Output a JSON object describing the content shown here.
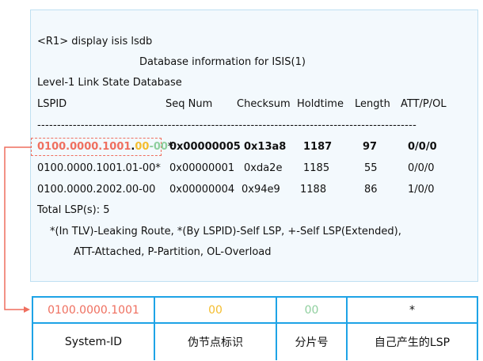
{
  "terminal": {
    "command": "<R1> display isis lsdb",
    "title": "Database information for ISIS(1)",
    "level": "Level-1 Link State Database",
    "headers": [
      "LSPID",
      "Seq Num",
      "Checksum",
      "Holdtime",
      "Length",
      "ATT/P/OL"
    ],
    "separator": "------------------------------------------------------------------------------------------------",
    "highlight_row": {
      "system_id": "0100.0000.1001",
      "dot": ".",
      "pseudo": "00",
      "dash": "-",
      "frag": "00",
      "star": "*",
      "seq": "0x00000005",
      "checksum": "0x13a8",
      "holdtime": "1187",
      "length": "97",
      "att": "0/0/0"
    },
    "rows": [
      {
        "lspid": "0100.0000.1001.01-00*",
        "seq": "0x00000001",
        "checksum": "0xda2e",
        "holdtime": "1185",
        "length": "55",
        "att": "0/0/0"
      },
      {
        "lspid": "0100.0000.2002.00-00",
        "seq": "0x00000004",
        "checksum": "0x94e9",
        "holdtime": "1188",
        "length": "86",
        "att": "1/0/0"
      }
    ],
    "total": "Total LSP(s): 5",
    "legend1": "*(In TLV)-Leaking Route, *(By LSPID)-Self LSP, +-Self LSP(Extended),",
    "legend2": "ATT-Attached, P-Partition, OL-Overload"
  },
  "table": {
    "values": [
      "0100.0000.1001",
      "00",
      "00",
      "*"
    ],
    "labels": [
      "System-ID",
      "伪节点标识",
      "分片号",
      "自己产生的LSP"
    ]
  },
  "colors": {
    "system_id": "#ef6f5f",
    "pseudo": "#f4bd2e",
    "frag": "#8fcf9e",
    "border": "#1ea3e6"
  }
}
